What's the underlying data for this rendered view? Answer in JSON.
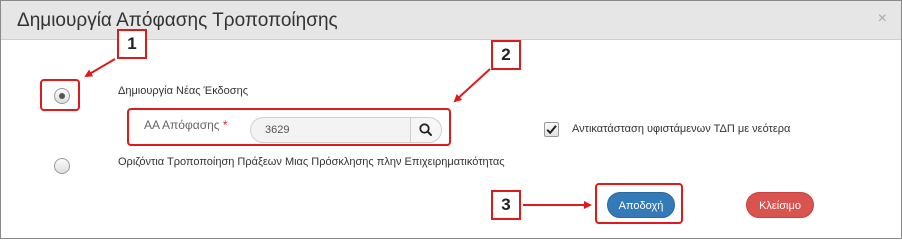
{
  "dialog": {
    "title": "Δημιουργία Απόφασης Τροποποίησης",
    "close_symbol": "×"
  },
  "options": {
    "new_version_label": "Δημιουργία Νέας Έκδοσης",
    "horizontal_label": "Οριζόντια Τροποποίηση Πράξεων Μιας Πρόσκλησης πλην Επιχειρηματικότητας"
  },
  "decision_field": {
    "label": "ΑΑ Απόφασης",
    "required_mark": "*",
    "value": "3629"
  },
  "replace_checkbox": {
    "label": "Αντικατάσταση υφιστάμενων ΤΔΠ με νεότερα",
    "checked": true
  },
  "buttons": {
    "accept_label": "Αποδοχή",
    "close_label": "Κλείσιμο"
  },
  "callouts": [
    "1",
    "2",
    "3"
  ],
  "colors": {
    "accent": "#337ab7",
    "danger": "#d9534f",
    "annotation": "#e0191b"
  },
  "icons": {
    "search": "search-icon",
    "close": "close-icon",
    "check": "checkmark-icon"
  }
}
